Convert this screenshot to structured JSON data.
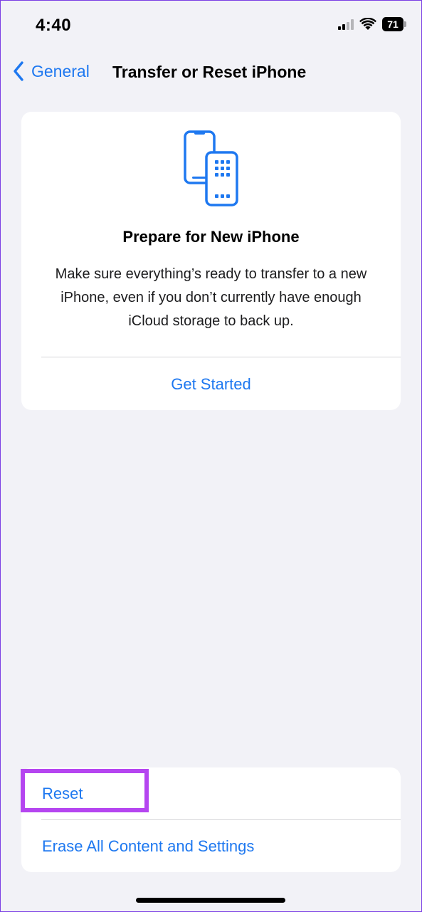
{
  "status_bar": {
    "time": "4:40",
    "battery": "71"
  },
  "nav": {
    "back_label": "General",
    "title": "Transfer or Reset iPhone"
  },
  "prepare": {
    "icon": "two-phones-transfer-icon",
    "title": "Prepare for New iPhone",
    "description": "Make sure everything’s ready to transfer to a new iPhone, even if you don’t currently have enough iCloud storage to back up.",
    "action_label": "Get Started"
  },
  "options": {
    "reset_label": "Reset",
    "erase_label": "Erase All Content and Settings"
  },
  "colors": {
    "accent": "#1e78f0",
    "highlight": "#b545f0",
    "background": "#f2f2f7"
  }
}
